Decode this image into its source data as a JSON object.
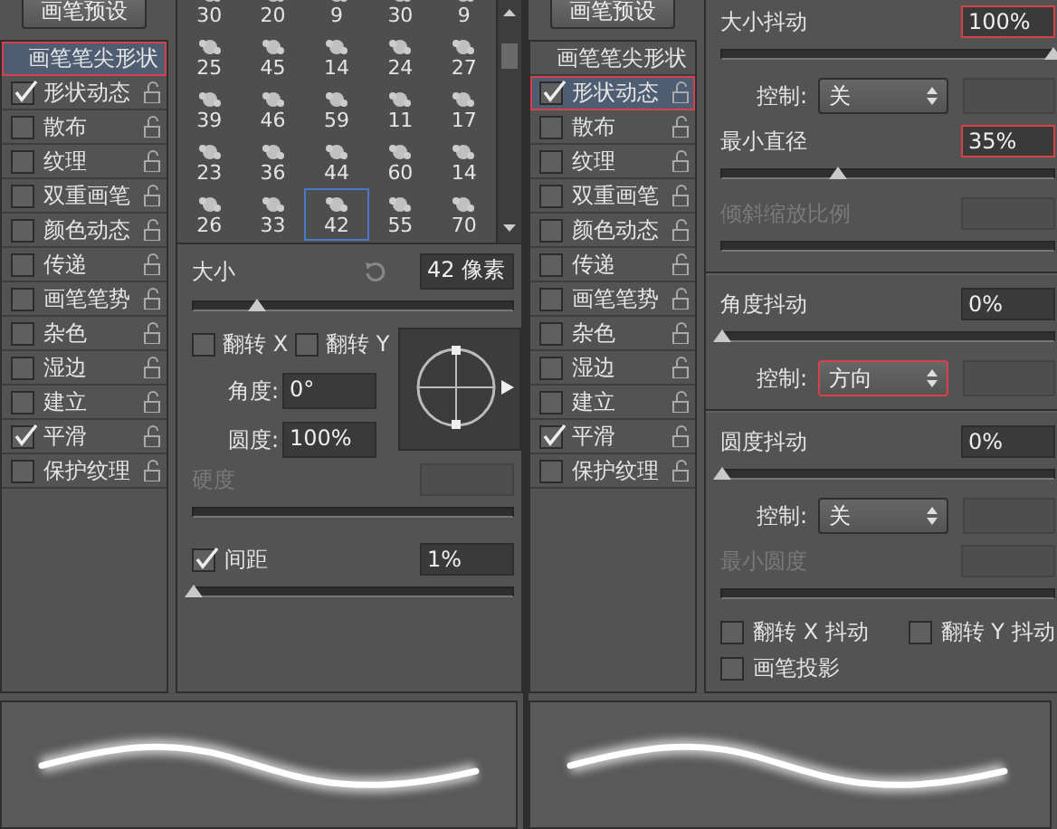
{
  "panels": [
    {
      "preset_button": "画笔预设",
      "sidebar": [
        {
          "kind": "header",
          "label": "画笔笔尖形状",
          "selected": true,
          "highlighted": true
        },
        {
          "kind": "option",
          "label": "形状动态",
          "checked": true,
          "selected": false,
          "highlighted": false
        },
        {
          "kind": "option",
          "label": "散布",
          "checked": false,
          "selected": false,
          "highlighted": false
        },
        {
          "kind": "option",
          "label": "纹理",
          "checked": false,
          "selected": false,
          "highlighted": false
        },
        {
          "kind": "option",
          "label": "双重画笔",
          "checked": false,
          "selected": false,
          "highlighted": false
        },
        {
          "kind": "option",
          "label": "颜色动态",
          "checked": false,
          "selected": false,
          "highlighted": false
        },
        {
          "kind": "option",
          "label": "传递",
          "checked": false,
          "selected": false,
          "highlighted": false
        },
        {
          "kind": "option",
          "label": "画笔笔势",
          "checked": false,
          "selected": false,
          "highlighted": false
        },
        {
          "kind": "option",
          "label": "杂色",
          "checked": false,
          "selected": false,
          "highlighted": false
        },
        {
          "kind": "option",
          "label": "湿边",
          "checked": false,
          "selected": false,
          "highlighted": false
        },
        {
          "kind": "option",
          "label": "建立",
          "checked": false,
          "selected": false,
          "highlighted": false
        },
        {
          "kind": "option",
          "label": "平滑",
          "checked": true,
          "selected": false,
          "highlighted": false
        },
        {
          "kind": "option",
          "label": "保护纹理",
          "checked": false,
          "selected": false,
          "highlighted": false
        }
      ],
      "options": [
        {
          "kind": "tip_grid",
          "tips": [
            {
              "size": "30",
              "selected": false
            },
            {
              "size": "20",
              "selected": false
            },
            {
              "size": "9",
              "selected": false
            },
            {
              "size": "30",
              "selected": false
            },
            {
              "size": "9",
              "selected": false
            },
            {
              "size": "25",
              "selected": false
            },
            {
              "size": "45",
              "selected": false
            },
            {
              "size": "14",
              "selected": false
            },
            {
              "size": "24",
              "selected": false
            },
            {
              "size": "27",
              "selected": false
            },
            {
              "size": "39",
              "selected": false
            },
            {
              "size": "46",
              "selected": false
            },
            {
              "size": "59",
              "selected": false
            },
            {
              "size": "11",
              "selected": false
            },
            {
              "size": "17",
              "selected": false
            },
            {
              "size": "23",
              "selected": false
            },
            {
              "size": "36",
              "selected": false
            },
            {
              "size": "44",
              "selected": false
            },
            {
              "size": "60",
              "selected": false
            },
            {
              "size": "14",
              "selected": false
            },
            {
              "size": "26",
              "selected": false
            },
            {
              "size": "33",
              "selected": false
            },
            {
              "size": "42",
              "selected": true
            },
            {
              "size": "55",
              "selected": false
            },
            {
              "size": "70",
              "selected": false
            }
          ]
        },
        {
          "kind": "size",
          "label": "大小",
          "value": "42 像素"
        },
        {
          "kind": "slider",
          "level": 0.2
        },
        {
          "kind": "angle_block",
          "flips": [
            {
              "label": "翻转 X",
              "checked": false
            },
            {
              "label": "翻转 Y",
              "checked": false
            }
          ],
          "angle": {
            "label": "角度:",
            "value": "0°"
          },
          "roundness": {
            "label": "圆度:",
            "value": "100%"
          }
        },
        {
          "kind": "value",
          "label": "硬度",
          "disabled": true,
          "highlighted": false
        },
        {
          "kind": "slider"
        },
        {
          "kind": "check_value",
          "label": "间距",
          "checked": true,
          "value": "1%"
        },
        {
          "kind": "slider",
          "level": 0
        }
      ]
    },
    {
      "preset_button": "画笔预设",
      "sidebar": [
        {
          "kind": "header",
          "label": "画笔笔尖形状",
          "selected": false,
          "highlighted": false
        },
        {
          "kind": "option",
          "label": "形状动态",
          "checked": true,
          "selected": true,
          "highlighted": true
        },
        {
          "kind": "option",
          "label": "散布",
          "checked": false,
          "selected": false,
          "highlighted": false
        },
        {
          "kind": "option",
          "label": "纹理",
          "checked": false,
          "selected": false,
          "highlighted": false
        },
        {
          "kind": "option",
          "label": "双重画笔",
          "checked": false,
          "selected": false,
          "highlighted": false
        },
        {
          "kind": "option",
          "label": "颜色动态",
          "checked": false,
          "selected": false,
          "highlighted": false
        },
        {
          "kind": "option",
          "label": "传递",
          "checked": false,
          "selected": false,
          "highlighted": false
        },
        {
          "kind": "option",
          "label": "画笔笔势",
          "checked": false,
          "selected": false,
          "highlighted": false
        },
        {
          "kind": "option",
          "label": "杂色",
          "checked": false,
          "selected": false,
          "highlighted": false
        },
        {
          "kind": "option",
          "label": "湿边",
          "checked": false,
          "selected": false,
          "highlighted": false
        },
        {
          "kind": "option",
          "label": "建立",
          "checked": false,
          "selected": false,
          "highlighted": false
        },
        {
          "kind": "option",
          "label": "平滑",
          "checked": true,
          "selected": false,
          "highlighted": false
        },
        {
          "kind": "option",
          "label": "保护纹理",
          "checked": false,
          "selected": false,
          "highlighted": false
        }
      ],
      "options": [
        {
          "kind": "value",
          "label": "大小抖动",
          "value": "100%",
          "disabled": false,
          "highlighted": true
        },
        {
          "kind": "slider",
          "level": 1
        },
        {
          "kind": "control",
          "label": "控制:",
          "value": "关",
          "highlighted": false
        },
        {
          "kind": "value",
          "label": "最小直径",
          "value": "35%",
          "disabled": false,
          "highlighted": true
        },
        {
          "kind": "slider",
          "level": 0.35
        },
        {
          "kind": "value",
          "label": "倾斜缩放比例",
          "disabled": true,
          "highlighted": false
        },
        {
          "kind": "slider"
        },
        {
          "kind": "divider"
        },
        {
          "kind": "value",
          "label": "角度抖动",
          "value": "0%",
          "disabled": false,
          "highlighted": false
        },
        {
          "kind": "slider",
          "level": 0
        },
        {
          "kind": "control",
          "label": "控制:",
          "value": "方向",
          "highlighted": true
        },
        {
          "kind": "divider"
        },
        {
          "kind": "value",
          "label": "圆度抖动",
          "value": "0%",
          "disabled": false,
          "highlighted": false
        },
        {
          "kind": "slider",
          "level": 0
        },
        {
          "kind": "control",
          "label": "控制:",
          "value": "关",
          "highlighted": false
        },
        {
          "kind": "value",
          "label": "最小圆度",
          "disabled": true,
          "highlighted": false
        },
        {
          "kind": "slider"
        },
        {
          "kind": "checks",
          "items": [
            {
              "label": "翻转 X 抖动",
              "checked": false
            },
            {
              "label": "翻转 Y 抖动",
              "checked": false
            }
          ]
        },
        {
          "kind": "checks",
          "items": [
            {
              "label": "画笔投影",
              "checked": false
            }
          ]
        }
      ]
    }
  ]
}
